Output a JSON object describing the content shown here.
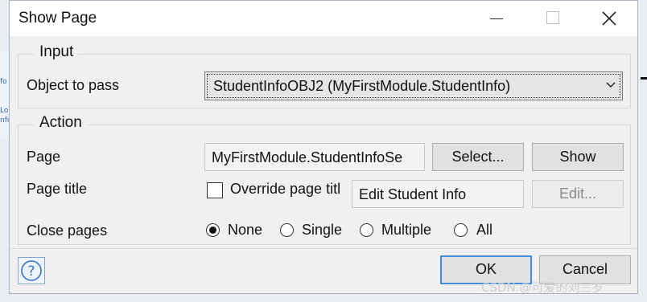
{
  "dialog": {
    "title": "Show Page",
    "colors": {
      "accent": "#3d8ee0",
      "background": "#f0f0f0"
    }
  },
  "input_group": {
    "legend": "Input",
    "object_label": "Object to pass",
    "object_value": "StudentInfoOBJ2 (MyFirstModule.StudentInfo)"
  },
  "action_group": {
    "legend": "Action",
    "page_label": "Page",
    "page_value": "MyFirstModule.StudentInfoSe",
    "select_button": "Select...",
    "show_button": "Show",
    "page_title_label": "Page title",
    "override_label": "Override page titl",
    "override_checked": false,
    "title_value": "Edit Student Info",
    "edit_button": "Edit...",
    "close_label": "Close pages",
    "close_options": [
      "None",
      "Single",
      "Multiple",
      "All"
    ],
    "close_selected": "None"
  },
  "footer": {
    "ok_label": "OK",
    "cancel_label": "Cancel",
    "watermark": "CSDN @可爱的刘三岁"
  },
  "background": {
    "fragments": [
      "fo",
      "Lol",
      "nfo"
    ]
  }
}
